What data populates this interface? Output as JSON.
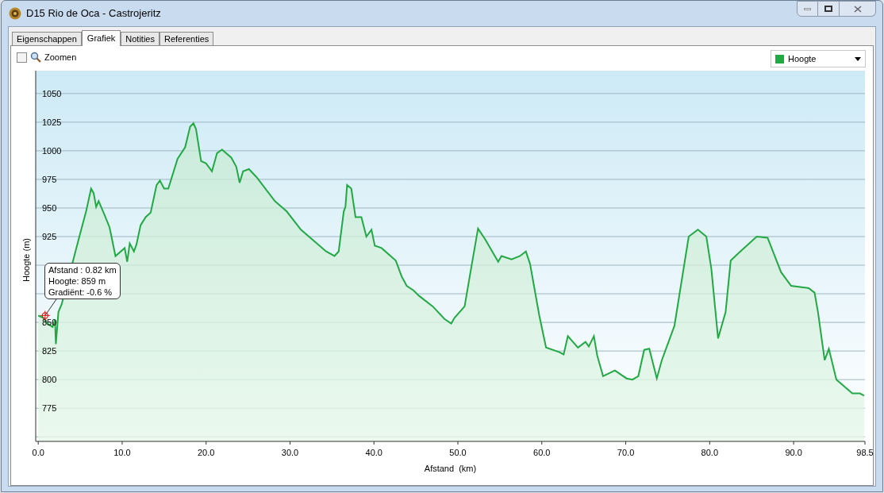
{
  "window": {
    "title": "D15 Rio de Oca - Castrojeritz"
  },
  "tabs": [
    {
      "label": "Eigenschappen",
      "selected": false
    },
    {
      "label": "Grafiek",
      "selected": true
    },
    {
      "label": "Notities",
      "selected": false
    },
    {
      "label": "Referenties",
      "selected": false
    }
  ],
  "zoom": {
    "label": "Zoomen",
    "checked": false
  },
  "tooltip": {
    "lines": [
      "Afstand : 0.82 km",
      "Hoogte: 859 m",
      "Gradiënt: -0.6 %"
    ]
  },
  "chart_data": {
    "type": "area",
    "grid": true,
    "xlabel": "Afstand  (km)",
    "ylabel": "Hoogte (m)",
    "xlim": [
      -0.3,
      98.5
    ],
    "ylim": [
      746,
      1070
    ],
    "xticks": [
      {
        "value": 0,
        "label": "0.0"
      },
      {
        "value": 10,
        "label": "10.0"
      },
      {
        "value": 20,
        "label": "20.0"
      },
      {
        "value": 30,
        "label": "30.0"
      },
      {
        "value": 40,
        "label": "40.0"
      },
      {
        "value": 50,
        "label": "50.0"
      },
      {
        "value": 60,
        "label": "60.0"
      },
      {
        "value": 70,
        "label": "70.0"
      },
      {
        "value": 80,
        "label": "80.0"
      },
      {
        "value": 90,
        "label": "90.0"
      },
      {
        "value": 98.5,
        "label": "98.5"
      }
    ],
    "yticks": [
      775,
      800,
      825,
      850,
      925,
      950,
      975,
      1000,
      1025,
      1050
    ],
    "x": [
      0,
      0.6,
      1.1,
      1.7,
      2.0,
      2.1,
      2.4,
      2.8,
      3.4,
      4.1,
      4.9,
      5.7,
      6.3,
      6.6,
      6.9,
      7.2,
      7.9,
      8.5,
      9.2,
      10.3,
      10.6,
      10.9,
      11.4,
      11.7,
      12.2,
      12.8,
      13.4,
      14.1,
      14.5,
      15.0,
      15.5,
      16.6,
      17.5,
      18.1,
      18.5,
      18.8,
      19.4,
      20.0,
      20.7,
      21.3,
      21.9,
      23.0,
      23.6,
      24.0,
      24.4,
      25.1,
      26.0,
      28.2,
      29.6,
      31.3,
      34.3,
      35.3,
      35.8,
      36.4,
      36.6,
      36.8,
      37.3,
      37.8,
      38.5,
      39.1,
      39.7,
      40.1,
      40.9,
      42.6,
      43.3,
      43.9,
      44.7,
      45.4,
      47.0,
      48.4,
      49.2,
      49.6,
      50.8,
      51.5,
      52.4,
      53.3,
      54.8,
      55.2,
      56.4,
      57.4,
      58.1,
      58.6,
      59.7,
      60.5,
      62.1,
      62.6,
      63.1,
      64.3,
      65.2,
      65.6,
      66.2,
      66.6,
      67.3,
      68.7,
      70.1,
      70.8,
      71.5,
      72.2,
      72.8,
      73.7,
      74.3,
      75.8,
      77.5,
      78.6,
      79.6,
      80.2,
      81.0,
      81.9,
      82.5,
      83.5,
      85.6,
      86.9,
      88.5,
      89.7,
      91.8,
      92.5,
      92.9,
      93.7,
      94.2,
      95.1,
      97.0,
      97.9,
      98.4
    ],
    "series": [
      {
        "name": "Hoogte",
        "color": "#22a844",
        "values": [
          856,
          854,
          849,
          846,
          852,
          831,
          859,
          866,
          null,
          null,
          925,
          947,
          967,
          963,
          951,
          956,
          944,
          933,
          908,
          915,
          903,
          919,
          912,
          918,
          935,
          942,
          946,
          970,
          974,
          967,
          967,
          993,
          1003,
          1021,
          1024,
          1019,
          991,
          989,
          982,
          998,
          1001,
          994,
          986,
          972,
          982,
          984,
          977,
          956,
          947,
          931,
          912,
          908,
          912,
          947,
          951,
          970,
          967,
          942,
          942,
          925,
          931,
          917,
          915,
          904,
          890,
          882,
          878,
          873,
          864,
          853,
          849,
          854,
          864,
          894,
          932,
          922,
          903,
          908,
          905,
          908,
          912,
          901,
          856,
          828,
          824,
          822,
          838,
          828,
          833,
          829,
          838,
          821,
          803,
          808,
          801,
          800,
          803,
          826,
          827,
          801,
          817,
          847,
          925,
          931,
          925,
          897,
          836,
          859,
          904,
          911,
          925,
          924,
          894,
          882,
          880,
          876,
          859,
          817,
          827,
          800,
          788,
          788,
          786
        ]
      }
    ]
  }
}
